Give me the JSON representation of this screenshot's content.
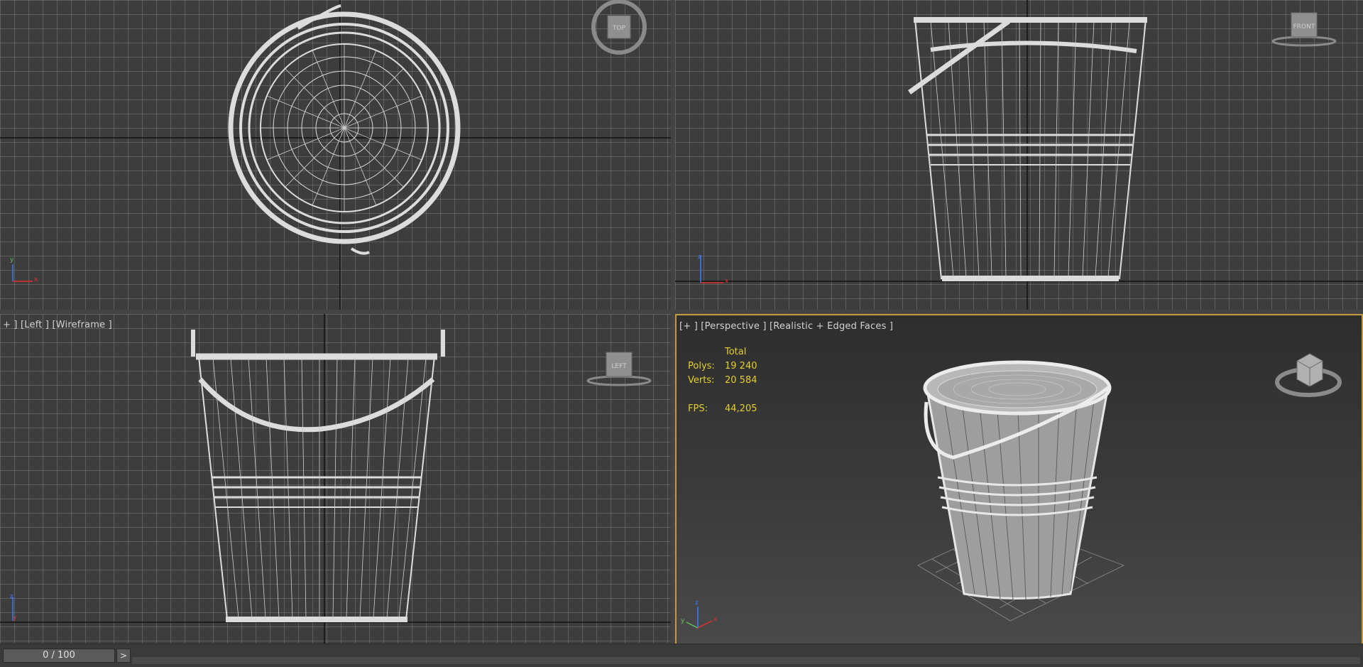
{
  "viewports": {
    "top": {
      "label": "",
      "gizmo": "TOP"
    },
    "front": {
      "label": "",
      "gizmo": "FRONT"
    },
    "left": {
      "label": "+ ] [Left ] [Wireframe ]",
      "gizmo": "LEFT"
    },
    "perspective": {
      "label": "[+ ] [Perspective ] [Realistic + Edged Faces ]"
    }
  },
  "stats": {
    "header": "Total",
    "polys_label": "Polys:",
    "polys_value": "19 240",
    "verts_label": "Verts:",
    "verts_value": "20 584",
    "fps_label": "FPS:",
    "fps_value": "44,205"
  },
  "timeline": {
    "frame": "0 / 100",
    "next": ">"
  },
  "colors": {
    "active_border": "#c39a3c",
    "stats_text": "#e4cf2e",
    "wire": "#d8d8d8"
  }
}
